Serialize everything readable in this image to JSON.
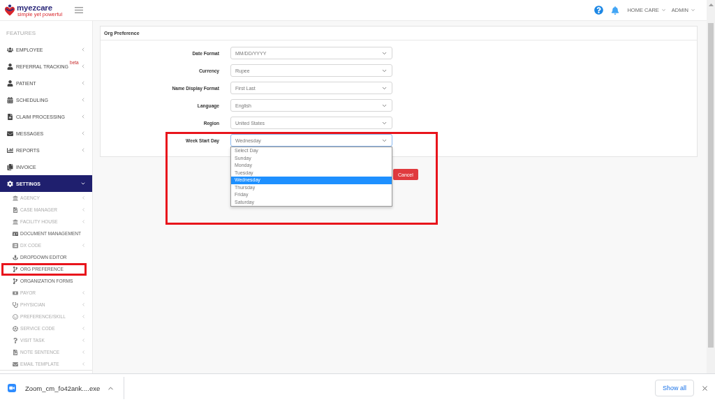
{
  "header": {
    "logo": {
      "name": "myezcare",
      "tagline": "simple yet powerful"
    },
    "menus": [
      {
        "label": "HOME CARE"
      },
      {
        "label": "ADMIN"
      }
    ]
  },
  "sidebar": {
    "section_title": "FEATURES",
    "items": [
      {
        "label": "EMPLOYEE",
        "kind": "group",
        "expanded": false,
        "selected": false
      },
      {
        "label": "REFERRAL TRACKING",
        "badge": "beta",
        "kind": "group",
        "expanded": false,
        "selected": false
      },
      {
        "label": "PATIENT",
        "kind": "group",
        "expanded": false,
        "selected": false
      },
      {
        "label": "SCHEDULING",
        "kind": "group",
        "expanded": false,
        "selected": false
      },
      {
        "label": "CLAIM PROCESSING",
        "kind": "group",
        "expanded": false,
        "selected": false
      },
      {
        "label": "MESSAGES",
        "kind": "group",
        "expanded": false,
        "selected": false
      },
      {
        "label": "REPORTS",
        "kind": "group",
        "expanded": false,
        "selected": false
      },
      {
        "label": "INVOICE",
        "kind": "page",
        "selected": false
      },
      {
        "label": "SETTINGS",
        "kind": "group",
        "expanded": true,
        "selected": true,
        "children": [
          {
            "label": "AGENCY",
            "kind": "group",
            "highlighted": false
          },
          {
            "label": "CASE MANAGER",
            "kind": "group",
            "highlighted": false
          },
          {
            "label": "FACILITY HOUSE",
            "kind": "group",
            "highlighted": false
          },
          {
            "label": "DOCUMENT MANAGEMENT",
            "kind": "page",
            "highlighted": false
          },
          {
            "label": "DX CODE",
            "kind": "group",
            "highlighted": false
          },
          {
            "label": "DROPDOWN EDITOR",
            "kind": "page",
            "highlighted": false
          },
          {
            "label": "ORG PREFERENCE",
            "kind": "page",
            "highlighted": true
          },
          {
            "label": "ORGANIZATION FORMS",
            "kind": "page",
            "highlighted": false
          },
          {
            "label": "PAYOR",
            "kind": "group",
            "highlighted": false
          },
          {
            "label": "PHYSICIAN",
            "kind": "group",
            "highlighted": false
          },
          {
            "label": "PREFERENCE/SKILL",
            "kind": "group",
            "highlighted": false
          },
          {
            "label": "SERVICE CODE",
            "kind": "group",
            "highlighted": false
          },
          {
            "label": "VISIT TASK",
            "kind": "group",
            "highlighted": false
          },
          {
            "label": "NOTE SENTENCE",
            "kind": "group",
            "highlighted": false
          },
          {
            "label": "EMAIL TEMPLATE",
            "kind": "group",
            "highlighted": false
          }
        ]
      }
    ]
  },
  "card": {
    "title": "Org Preference",
    "fields": [
      {
        "label": "Date Format",
        "value": "MM/DD/YYYY",
        "open": false,
        "highlighted": false
      },
      {
        "label": "Currency",
        "value": "Rupee",
        "open": false,
        "highlighted": false
      },
      {
        "label": "Name Display Format",
        "value": "First Last",
        "open": false,
        "highlighted": false
      },
      {
        "label": "Language",
        "value": "English",
        "open": false,
        "highlighted": false
      },
      {
        "label": "Region",
        "value": "United States",
        "open": false,
        "highlighted": false
      },
      {
        "label": "Week Start Day",
        "value": "Wednesday",
        "open": true,
        "highlighted": true,
        "options": [
          {
            "label": "Select Day",
            "selected": false
          },
          {
            "label": "Sunday",
            "selected": false
          },
          {
            "label": "Monday",
            "selected": false
          },
          {
            "label": "Tuesday",
            "selected": false
          },
          {
            "label": "Wednesday",
            "selected": true
          },
          {
            "label": "Thursday",
            "selected": false
          },
          {
            "label": "Friday",
            "selected": false
          },
          {
            "label": "Saturday",
            "selected": false
          }
        ]
      }
    ]
  },
  "actions": [
    {
      "label": "Cancel"
    }
  ],
  "downloads": {
    "items": [
      {
        "file_name": "Zoom_cm_fo42ank....exe"
      }
    ],
    "show_all": "Show all"
  }
}
